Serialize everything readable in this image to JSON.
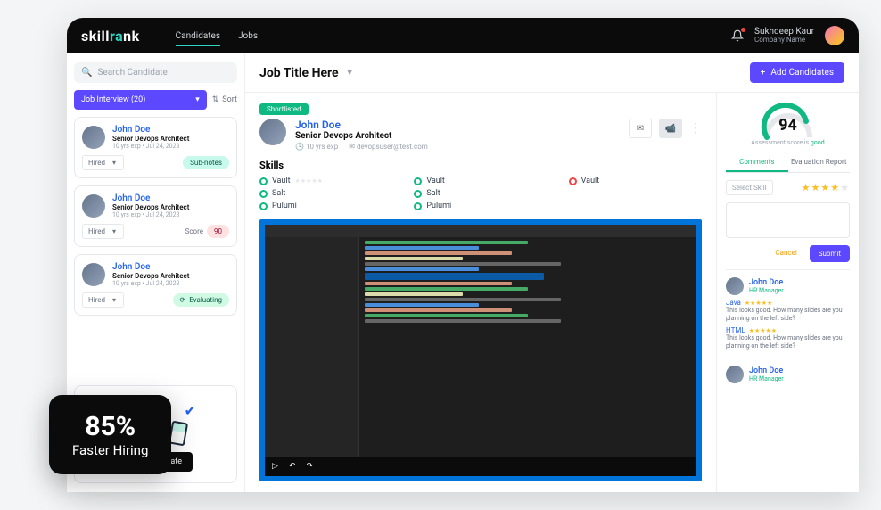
{
  "brand": {
    "pre": "skill",
    "accent": "ra",
    "post": "nk"
  },
  "nav": {
    "candidates": "Candidates",
    "jobs": "Jobs"
  },
  "user": {
    "name": "Sukhdeep Kaur",
    "company": "Company Name"
  },
  "sidebar": {
    "search_placeholder": "Search Candidate",
    "filter_label": "Job Interview (20)",
    "sort_label": "Sort",
    "cards": [
      {
        "name": "John Doe",
        "role": "Senior Devops Architect",
        "exp": "10 yrs exp",
        "date": "Jul 24, 2023",
        "status": "Hired",
        "sub_label": "Sub-notes"
      },
      {
        "name": "John Doe",
        "role": "Senior Devops Architect",
        "exp": "10 yrs exp",
        "date": "Jul 24, 2023",
        "status": "Hired",
        "score_label": "Score",
        "score_val": "90"
      },
      {
        "name": "John Doe",
        "role": "Senior Devops Architect",
        "exp": "10 yrs exp",
        "date": "Jul 24, 2023",
        "status": "Hired",
        "eval_label": "Evaluating"
      }
    ],
    "add_btn": "Add Candidate"
  },
  "header": {
    "job_title": "Job Title Here",
    "add_btn": "Add Candidates"
  },
  "detail": {
    "badge": "Shortlisted",
    "name": "John Doe",
    "role": "Senior Devops Architect",
    "exp": "10 yrs exp",
    "email": "devopsuser@test.com",
    "skills_title": "Skills",
    "skills": [
      {
        "name": "Vault",
        "state": "green",
        "stars": true
      },
      {
        "name": "Vault",
        "state": "green"
      },
      {
        "name": "Vault",
        "state": "red"
      },
      {
        "name": "Salt",
        "state": "green"
      },
      {
        "name": "Salt",
        "state": "green"
      },
      {
        "name": "",
        "state": ""
      },
      {
        "name": "Pulumi",
        "state": "green"
      },
      {
        "name": "Pulumi",
        "state": "green"
      },
      {
        "name": "",
        "state": ""
      }
    ]
  },
  "gauge": {
    "value": "94",
    "caption_pre": "Assessment score is ",
    "caption_good": "good"
  },
  "rail": {
    "tab1": "Comments",
    "tab2": "Evaluation Report",
    "select_skill": "Select Skill",
    "cancel": "Cancel",
    "submit": "Submit",
    "comments": [
      {
        "name": "John Doe",
        "role": "HR Manager",
        "items": [
          {
            "skill": "Java",
            "text": "This looks good. How many slides are you planning on the left side?"
          },
          {
            "skill": "HTML",
            "text": "This looks good. How many slides are you planning on the left side?"
          }
        ]
      },
      {
        "name": "John Doe",
        "role": "HR Manager",
        "items": []
      }
    ]
  },
  "overlay": {
    "big": "85%",
    "sub": "Faster Hiring"
  }
}
